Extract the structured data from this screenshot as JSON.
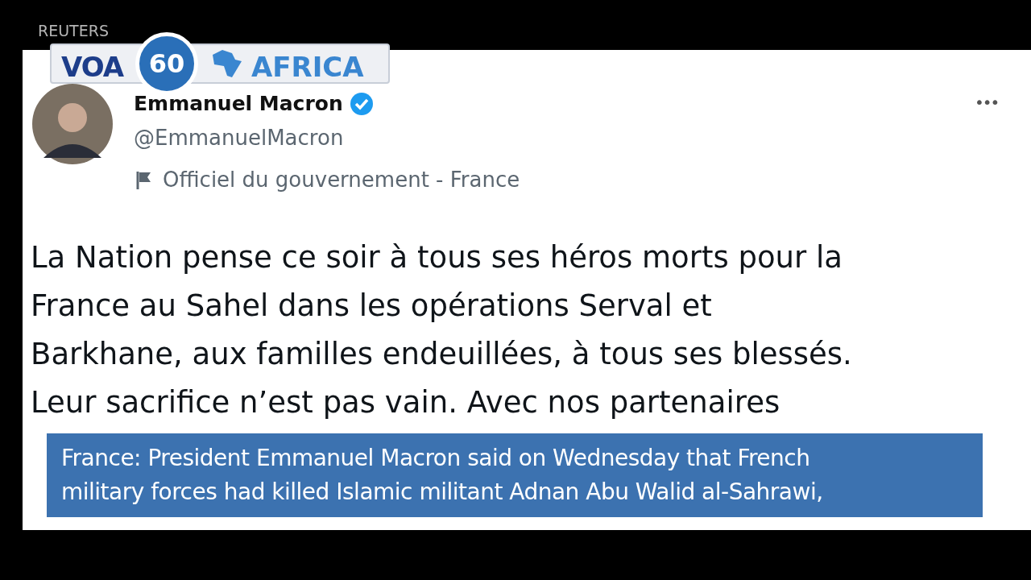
{
  "broadcast": {
    "source": "REUTERS",
    "logo": {
      "letters": "VOA",
      "number": "60",
      "region": "AFRICA"
    }
  },
  "tweet": {
    "author": "Emmanuel Macron",
    "verified": true,
    "handle": "@EmmanuelMacron",
    "label": "Officiel du gouvernement - France",
    "menu": "•••",
    "lines": [
      "La Nation pense ce soir à tous ses héros morts pour la",
      "France au Sahel dans les opérations Serval et",
      "Barkhane, aux familles endeuillées, à tous ses blessés.",
      "Leur sacrifice n’est pas vain. Avec nos partenaires"
    ]
  },
  "caption": {
    "lines": [
      "France: President Emmanuel Macron said on Wednesday that French",
      "military forces had killed Islamic militant Adnan Abu Walid al-Sahrawi,"
    ]
  }
}
